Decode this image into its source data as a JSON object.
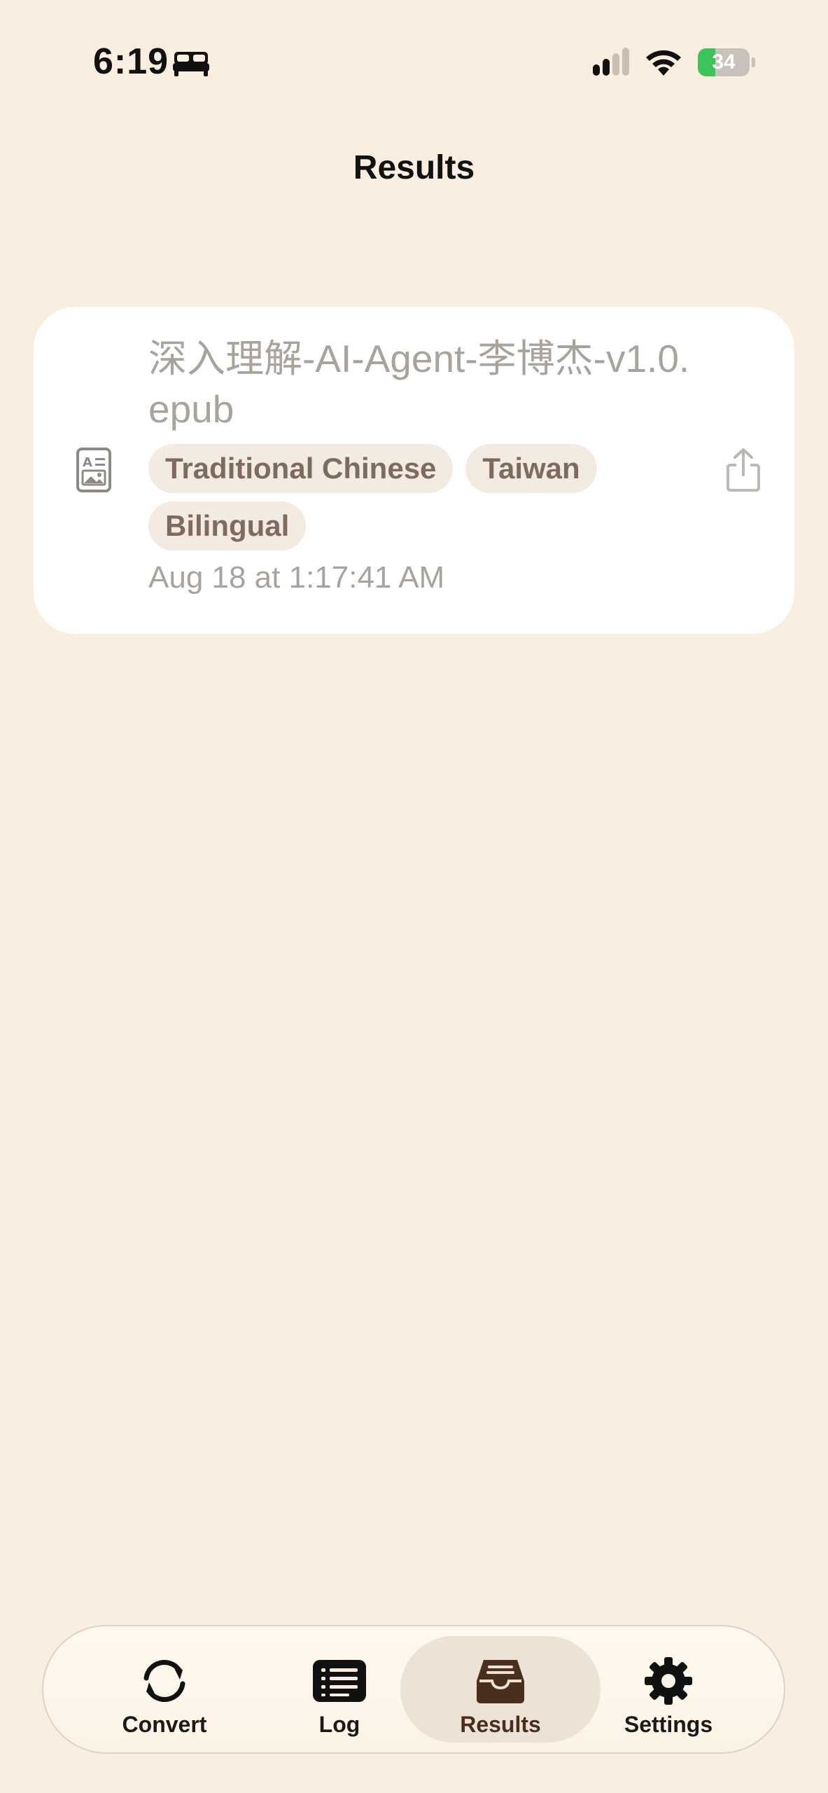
{
  "status_bar": {
    "time": "6:19",
    "battery_level": "34",
    "icons": [
      "bed-icon",
      "cellular-signal-icon",
      "wifi-icon",
      "battery-charging-icon"
    ]
  },
  "header": {
    "title": "Results"
  },
  "results": [
    {
      "file_name": "深入理解-AI-Agent-李博杰-v1.0.epub",
      "tags": [
        "Traditional Chinese",
        "Taiwan",
        "Bilingual"
      ],
      "timestamp": "Aug 18 at 1:17:41 AM",
      "icons": [
        "ebook-file-icon",
        "share-icon"
      ]
    }
  ],
  "tab_bar": {
    "active": "Results",
    "tabs": [
      {
        "label": "Convert",
        "icon": "convert-arrows-icon"
      },
      {
        "label": "Log",
        "icon": "log-list-icon"
      },
      {
        "label": "Results",
        "icon": "inbox-tray-icon"
      },
      {
        "label": "Settings",
        "icon": "gear-icon"
      }
    ]
  },
  "colors": {
    "background": "#F9EEE0",
    "card": "#FFFFFF",
    "tag_background": "#F3EBE2",
    "tag_text": "#7E6B5E",
    "muted_text": "#A8A39D",
    "active_tab": "#ECE2D6",
    "accent_brown": "#4A2E1E",
    "battery_green": "#3BC45A"
  }
}
